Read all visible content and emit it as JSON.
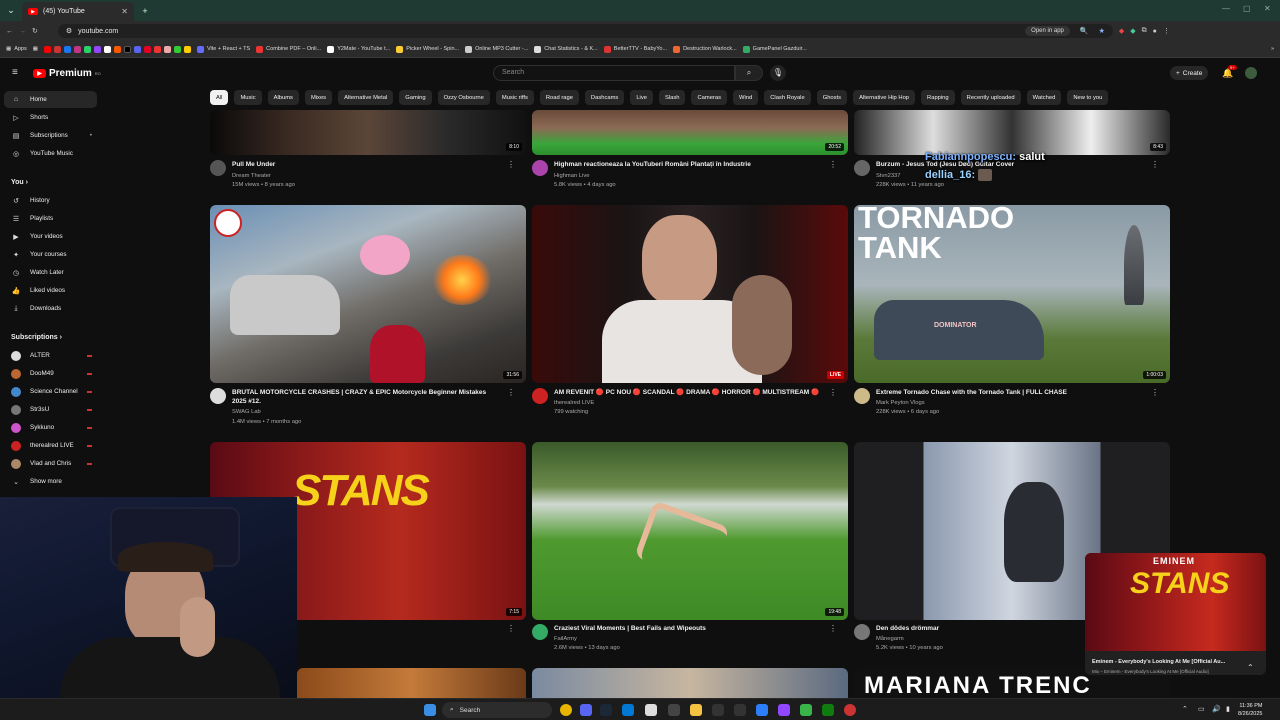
{
  "browser": {
    "tab_title": "(45) YouTube",
    "url": "youtube.com",
    "open_in_app": "Open in app",
    "bookmarks": [
      "Apps",
      "Vite + React + TS",
      "Combine PDF – Onli...",
      "Y2Mate - YouTube t...",
      "Picker Wheel - Spin...",
      "Online MP3 Cutter -...",
      "Chat Statistics - & K...",
      "BetterTTV - BabyYo...",
      "Destruction Warlock...",
      "GamePanel Gazduir..."
    ]
  },
  "youtube": {
    "logo": "Premium",
    "logo_sup": "RO",
    "search_placeholder": "Search",
    "create": "Create",
    "notif_count": "9+"
  },
  "sidebar": {
    "main": [
      "Home",
      "Shorts",
      "Subscriptions",
      "YouTube Music"
    ],
    "you_header": "You",
    "you": [
      "History",
      "Playlists",
      "Your videos",
      "Your courses",
      "Watch Later",
      "Liked videos",
      "Downloads"
    ],
    "subs_header": "Subscriptions",
    "subs": [
      "ALTER",
      "DooM49",
      "Science Channel",
      "Str3sU",
      "Sykkuno",
      "therealred LIVE",
      "Vlad and Chris"
    ],
    "show_more": "Show more"
  },
  "chips": [
    "All",
    "Music",
    "Albums",
    "Mixes",
    "Alternative Metal",
    "Gaming",
    "Ozzy Osbourne",
    "Music riffs",
    "Road rage",
    "Dashcams",
    "Live",
    "Slash",
    "Cameras",
    "Wind",
    "Clash Royale",
    "Ghosts",
    "Alternative Hip Hop",
    "Rapping",
    "Recently uploaded",
    "Watched",
    "New to you"
  ],
  "videos": {
    "r1c1": {
      "title": "Pull Me Under",
      "channel": "Dream Theater",
      "stats": "15M views • 8 years ago",
      "duration": "8:10"
    },
    "r1c2": {
      "title": "Highman reactioneaza la YouTuberi Români Plantați în Industrie",
      "channel": "Highman Live",
      "stats": "5.8K views • 4 days ago",
      "duration": "20:52"
    },
    "r1c3": {
      "title": "Burzum - Jesus Tod (Jesu Død) Guitar Cover",
      "channel": "Stvn2337",
      "stats": "228K views • 11 years ago",
      "duration": "8:43"
    },
    "r2c1": {
      "title": "BRUTAL MOTORCYCLE CRASHES | CRAZY & EPIC Motorcycle Beginner Mistakes 2025 #12.",
      "channel": "SWAG Lab",
      "stats": "1.4M views • 7 months ago",
      "duration": "31:56"
    },
    "r2c2": {
      "title": "AM REVENIT 🔴 PC NOU 🔴 SCANDAL 🔴 DRAMA 🔴 HORROR 🔴 MULTISTREAM 🔴",
      "channel": "therealred LIVE",
      "stats": "799 watching",
      "duration": "LIVE"
    },
    "r2c3": {
      "title": "Extreme Tornado Chase with the Tornado Tank | FULL CHASE",
      "channel": "Mark Peyton Vlogs",
      "stats": "228K views • 6 days ago",
      "duration": "1:00:03",
      "thumb_line1": "TORNADO",
      "thumb_line2": "TANK",
      "thumb_vehicle": "DOMINATOR"
    },
    "r3c1": {
      "title": "",
      "channel": "",
      "stats": "",
      "duration": "7:15",
      "thumb_text": "STANS"
    },
    "r3c2": {
      "title": "Craziest Viral Moments | Best Fails and Wipeouts",
      "channel": "FailArmy",
      "stats": "2.6M views • 13 days ago",
      "duration": "19:48"
    },
    "r3c3": {
      "title": "Den dödes drömmar",
      "channel": "Månegarm",
      "stats": "5.2K views • 10 years ago",
      "duration": ""
    },
    "r4c3": {
      "thumb_text": "MARIANA TRENC"
    }
  },
  "chat": [
    {
      "name": "Fabiannpopescu:",
      "msg": "salut"
    },
    {
      "name": "dellia_16:",
      "msg": ""
    }
  ],
  "miniplayer": {
    "title": "Eminem - Everybody's Looking At Me [Official Au...",
    "subtitle": "Mix – Eminem - Everybody's Looking At Me [Official Audio]",
    "brand": "EMINEM",
    "art": "STANS"
  },
  "taskbar": {
    "search": "Search",
    "time": "11:36 PM",
    "date": "8/26/2025"
  }
}
